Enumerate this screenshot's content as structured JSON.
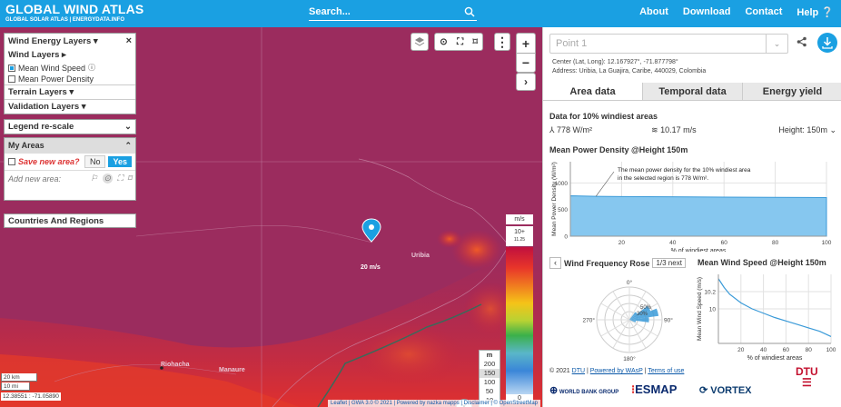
{
  "header": {
    "brand_title": "GLOBAL WIND ATLAS",
    "brand_subtitle": "GLOBAL SOLAR ATLAS | ENERGYDATA.INFO",
    "search_placeholder": "Search...",
    "nav": [
      "About",
      "Download",
      "Contact",
      "Help"
    ]
  },
  "layers_panel": {
    "title": "Wind Energy Layers",
    "wind_layers": "Wind Layers",
    "options": [
      {
        "label": "Mean Wind Speed",
        "checked": true
      },
      {
        "label": "Mean Power Density",
        "checked": false
      }
    ],
    "terrain_layers": "Terrain Layers",
    "validation_layers": "Validation Layers"
  },
  "legend_rescale": "Legend re-scale",
  "my_areas": {
    "title": "My Areas",
    "save_label": "Save new area?",
    "no": "No",
    "yes": "Yes",
    "add_label": "Add new area:"
  },
  "countries": "Countries And Regions",
  "map": {
    "marker_label": "20 m/s",
    "places": [
      "Uribia",
      "Riohacha",
      "Manaure"
    ],
    "legend_units": "m/s",
    "legend_top": [
      "10+",
      "11.25"
    ],
    "legend_bottom": "0",
    "heights_title": "m",
    "heights": [
      "200",
      "150",
      "100",
      "50",
      "10"
    ],
    "scale_km": "20 km",
    "scale_mi": "10 mi",
    "coords": "12.38551 : -71.05890",
    "attribution": "Leaflet | GWA 3.0 © 2021 | Powered by nazka mapps | Disclaimer | © OpenStreetMap"
  },
  "right": {
    "point": "Point 1",
    "center": "Center (Lat, Long): 12.167927°, -71.877798°",
    "address": "Address: Uribia, La Guajira, Caribe, 440029, Colombia",
    "tabs": [
      "Area data",
      "Temporal data",
      "Energy yield"
    ],
    "data_title": "Data for 10% windiest areas",
    "power": "778 W/m²",
    "speed": "10.17 m/s",
    "height": "Height: 150m",
    "power_chart_title": "Mean Power Density @Height 150m",
    "power_annotation_1": "The mean power density for the 10% windiest area",
    "power_annotation_2": "in the selected region is 778 W/m².",
    "rose_title": "Wind Frequency Rose",
    "rose_pager": "1/3",
    "rose_next": "next",
    "speed_chart_title": "Mean Wind Speed @Height 150m",
    "footer": {
      "copy": "© 2021",
      "dtu": "DTU",
      "wasp": "Powered by WAsP",
      "terms": "Terms of use"
    },
    "partners": [
      "WORLD BANK GROUP",
      "ESMAP",
      "VORTEX",
      "DTU"
    ]
  },
  "chart_data": [
    {
      "type": "area",
      "title": "Mean Power Density @Height 150m",
      "xlabel": "% of windiest areas",
      "ylabel": "Mean Power Density (W/m²)",
      "x": [
        0,
        10,
        20,
        40,
        60,
        80,
        100
      ],
      "y": [
        760,
        750,
        745,
        740,
        735,
        730,
        725
      ],
      "xticks": [
        20,
        40,
        60,
        80,
        100
      ],
      "yticks": [
        0,
        500,
        1000
      ],
      "xlim": [
        0,
        100
      ],
      "ylim": [
        0,
        1400
      ]
    },
    {
      "type": "line",
      "title": "Mean Wind Speed @Height 150m",
      "xlabel": "% of windiest areas",
      "ylabel": "Mean Wind Speed (m/s)",
      "x": [
        0,
        5,
        10,
        20,
        30,
        40,
        50,
        60,
        70,
        80,
        90,
        100
      ],
      "y": [
        10.35,
        10.25,
        10.17,
        10.07,
        10.0,
        9.95,
        9.9,
        9.86,
        9.82,
        9.78,
        9.74,
        9.68
      ],
      "xticks": [
        20,
        40,
        60,
        80,
        100
      ],
      "yticks": [
        10,
        10.2
      ],
      "xlim": [
        0,
        100
      ],
      "ylim": [
        9.6,
        10.4
      ]
    },
    {
      "type": "rose",
      "title": "Wind Frequency Rose",
      "directions": [
        "0°",
        "90°",
        "180°",
        "270°"
      ],
      "ring_labels": [
        "30%",
        "50%"
      ],
      "sectors_deg": [
        45,
        60,
        75,
        90,
        105
      ],
      "frequencies": [
        0.15,
        0.35,
        0.45,
        0.3,
        0.1
      ]
    }
  ]
}
